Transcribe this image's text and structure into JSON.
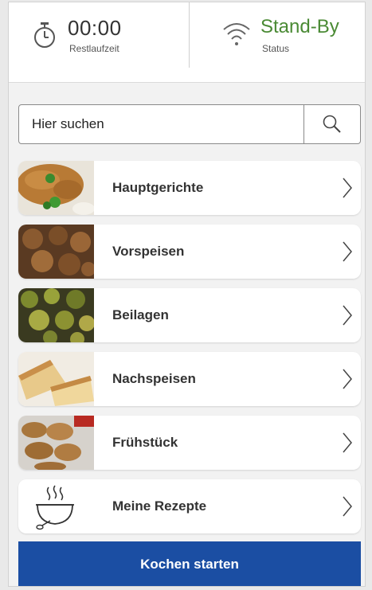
{
  "header": {
    "timer_value": "00:00",
    "timer_label": "Restlaufzeit",
    "status_value": "Stand-By",
    "status_label": "Status"
  },
  "search": {
    "placeholder": "Hier suchen"
  },
  "categories": [
    {
      "label": "Hauptgerichte",
      "image": "schnitzel-photo"
    },
    {
      "label": "Vorspeisen",
      "image": "fried-appetizers-photo"
    },
    {
      "label": "Beilagen",
      "image": "brussels-sprouts-photo"
    },
    {
      "label": "Nachspeisen",
      "image": "cake-slices-photo"
    },
    {
      "label": "Frühstück",
      "image": "oat-cookies-photo"
    },
    {
      "label": "Meine Rezepte",
      "image": "steaming-bowl-icon"
    }
  ],
  "actions": {
    "start_label": "Kochen starten"
  },
  "colors": {
    "status_green": "#4a8a34",
    "primary_blue": "#1b4ea3"
  }
}
